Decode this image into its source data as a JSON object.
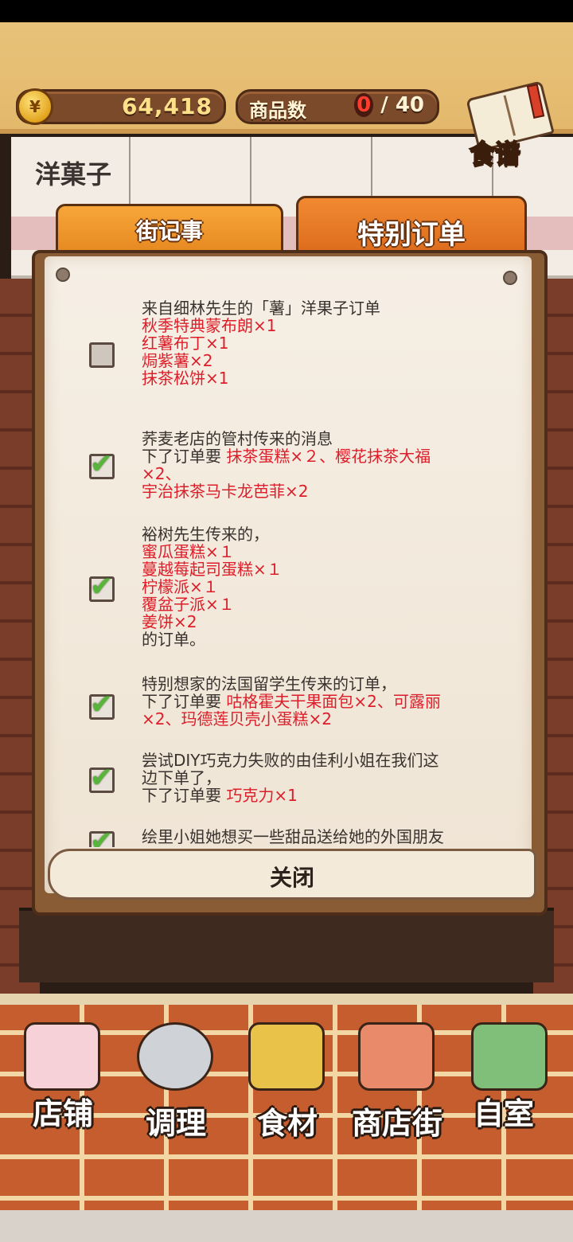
{
  "header": {
    "coins": "64,418",
    "coin_symbol": "¥",
    "goods_label": "商品数",
    "goods_current": "0",
    "goods_sep": "/",
    "goods_max": "40",
    "recipe_label": "食谱"
  },
  "shop": {
    "name": "洋菓子"
  },
  "tabs": [
    {
      "label": "街记事",
      "active": false
    },
    {
      "label": "特别订单",
      "active": true
    }
  ],
  "orders": [
    {
      "checked": false,
      "lines": [
        {
          "t": "来自细林先生的「薯」洋果子订单",
          "red": false
        },
        {
          "t": "秋季特典蒙布朗×1",
          "red": true
        },
        {
          "t": "红薯布丁×1",
          "red": true
        },
        {
          "t": "焗紫薯×2",
          "red": true
        },
        {
          "t": "抹茶松饼×1",
          "red": true
        }
      ]
    },
    {
      "checked": true,
      "lines": [
        {
          "t": "荞麦老店的管村传来的消息",
          "red": false
        },
        {
          "t": "下了订单要 ",
          "red": false,
          "tail": "抹茶蛋糕×２、樱花抹茶大福"
        },
        {
          "t": "×2、",
          "red": true
        },
        {
          "t": "宇治抹茶马卡龙芭菲×2",
          "red": true
        }
      ]
    },
    {
      "checked": true,
      "lines": [
        {
          "t": "裕树先生传来的，",
          "red": false
        },
        {
          "t": "蜜瓜蛋糕×１",
          "red": true
        },
        {
          "t": "蔓越莓起司蛋糕×１",
          "red": true
        },
        {
          "t": "柠檬派×１",
          "red": true
        },
        {
          "t": "覆盆子派×１",
          "red": true
        },
        {
          "t": "姜饼×2",
          "red": true
        },
        {
          "t": "的订单。",
          "red": false
        }
      ]
    },
    {
      "checked": true,
      "lines": [
        {
          "t": "特别想家的法国留学生传来的订单，",
          "red": false
        },
        {
          "t": "下了订单要 ",
          "red": false,
          "tail": "咕格霍夫干果面包×2、可露丽"
        },
        {
          "t": "×2、玛德莲贝壳小蛋糕×2",
          "red": true
        }
      ]
    },
    {
      "checked": true,
      "lines": [
        {
          "t": "尝试DIY巧克力失败的由佳利小姐在我们这",
          "red": false
        },
        {
          "t": "边下单了，",
          "red": false
        },
        {
          "t": "下了订单要 ",
          "red": false,
          "tail": "巧克力×1"
        }
      ]
    },
    {
      "checked": true,
      "lines": [
        {
          "t": "绘里小姐她想买一些甜品送给她的外国朋友",
          "red": false
        }
      ]
    }
  ],
  "close_label": "关闭",
  "nav": [
    {
      "label": "店铺",
      "icon": "cake-icon"
    },
    {
      "label": "调理",
      "icon": "mixing-bowl-icon"
    },
    {
      "label": "食材",
      "icon": "flour-bag-icon"
    },
    {
      "label": "商店街",
      "icon": "storefront-icon"
    },
    {
      "label": "自室",
      "icon": "staff-door-icon"
    }
  ]
}
